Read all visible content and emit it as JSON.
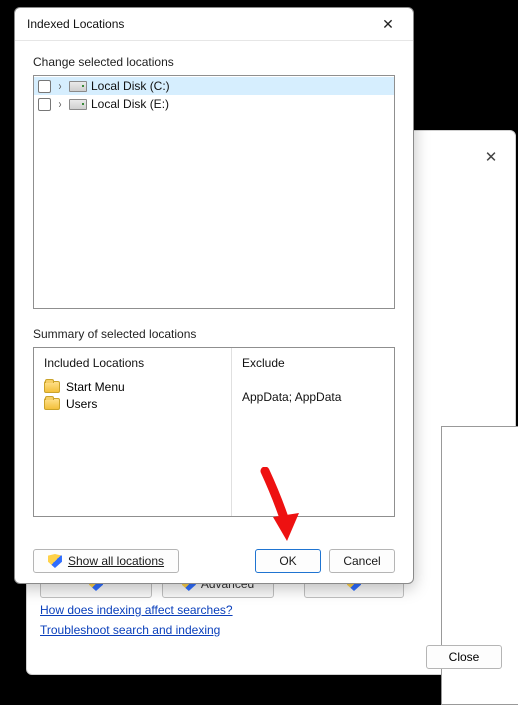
{
  "dialog": {
    "title": "Indexed Locations",
    "change_label": "Change selected locations",
    "locations": [
      {
        "label": "Local Disk (C:)",
        "selected": true
      },
      {
        "label": "Local Disk (E:)",
        "selected": false
      }
    ],
    "summary_label": "Summary of selected locations",
    "included_header": "Included Locations",
    "exclude_header": "Exclude",
    "included": [
      {
        "label": "Start Menu"
      },
      {
        "label": "Users"
      }
    ],
    "exclude_text": "AppData; AppData",
    "show_all_label": "Show all locations",
    "ok_label": "OK",
    "cancel_label": "Cancel"
  },
  "parent": {
    "peek2_label": "Advanced",
    "link1": "How does indexing affect searches?",
    "link2": "Troubleshoot search and indexing",
    "close_label": "Close"
  }
}
